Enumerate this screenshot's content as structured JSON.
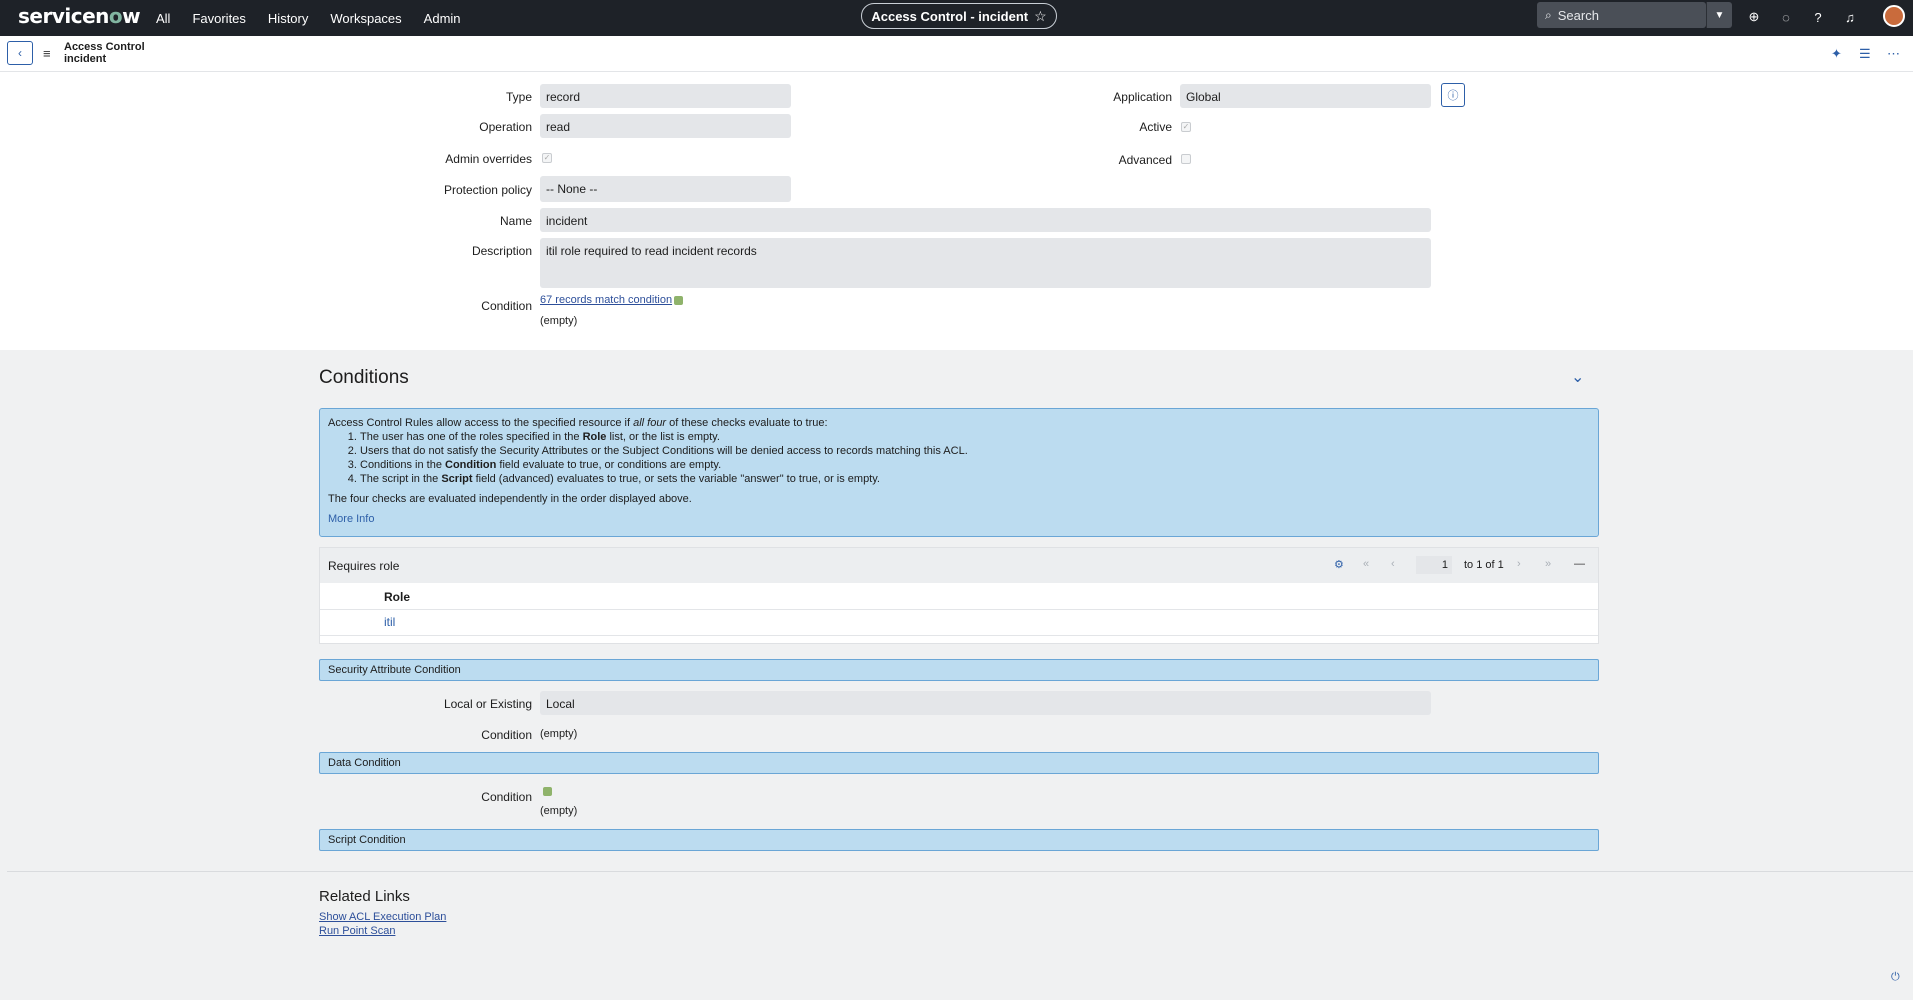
{
  "nav": {
    "logo_pre": "servicen",
    "logo_o": "o",
    "logo_post": "w",
    "menu": [
      "All",
      "Favorites",
      "History",
      "Workspaces",
      "Admin"
    ],
    "context_title": "Access Control - incident",
    "search_placeholder": "Search"
  },
  "record_header": {
    "title_line1": "Access Control",
    "title_line2": "incident"
  },
  "form": {
    "type_label": "Type",
    "type_value": "record",
    "operation_label": "Operation",
    "operation_value": "read",
    "admin_overrides_label": "Admin overrides",
    "protection_policy_label": "Protection policy",
    "protection_policy_value": "-- None --",
    "name_label": "Name",
    "name_value": "incident",
    "description_label": "Description",
    "description_value": "itil role required to read incident records",
    "condition_label": "Condition",
    "condition_link": "67 records match condition",
    "condition_value": "(empty)",
    "application_label": "Application",
    "application_value": "Global",
    "active_label": "Active",
    "advanced_label": "Advanced"
  },
  "conditions": {
    "title": "Conditions",
    "info_intro_pre": "Access Control Rules allow access to the specified resource if ",
    "info_intro_em": "all four",
    "info_intro_post": " of these checks evaluate to true:",
    "item1_pre": "The user has one of the roles specified in the ",
    "item1_b": "Role",
    "item1_post": " list, or the list is empty.",
    "item2": "Users that do not satisfy the Security Attributes or the Subject Conditions will be denied access to records matching this ACL.",
    "item3_pre": "Conditions in the ",
    "item3_b": "Condition",
    "item3_post": " field evaluate to true, or conditions are empty.",
    "item4_pre": "The script in the ",
    "item4_b": "Script",
    "item4_post": " field (advanced) evaluates to true, or sets the variable \"answer\" to true, or is empty.",
    "info_footer": "The four checks are evaluated independently in the order displayed above.",
    "more_info": "More Info"
  },
  "requires_role": {
    "title": "Requires role",
    "page_number": "1",
    "page_text": "to 1 of 1",
    "column": "Role",
    "rows": [
      "itil"
    ]
  },
  "security_attr": {
    "bar": "Security Attribute Condition",
    "local_label": "Local or Existing",
    "local_value": "Local",
    "condition_label": "Condition",
    "condition_value": "(empty)"
  },
  "data_condition": {
    "bar": "Data Condition",
    "condition_label": "Condition",
    "condition_value": "(empty)"
  },
  "script_condition": {
    "bar": "Script Condition"
  },
  "related_links": {
    "title": "Related Links",
    "links": [
      "Show ACL Execution Plan",
      "Run Point Scan"
    ]
  }
}
